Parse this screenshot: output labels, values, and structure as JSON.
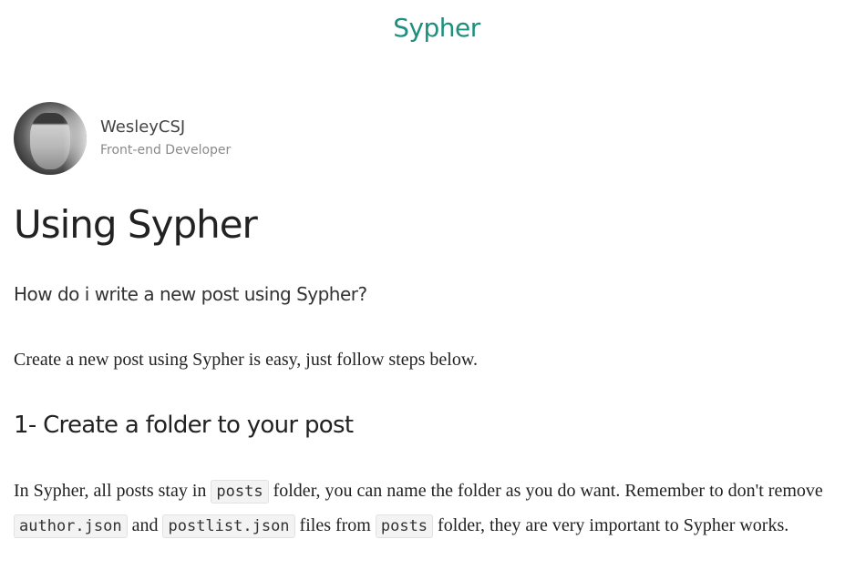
{
  "site": {
    "title": "Sypher"
  },
  "author": {
    "name": "WesleyCSJ",
    "role": "Front-end Developer"
  },
  "post": {
    "title": "Using Sypher",
    "subtitle": "How do i write a new post using Sypher?",
    "intro": "Create a new post using Sypher is easy, just follow steps below.",
    "section1": {
      "heading": "1- Create a folder to your post",
      "text1": "In Sypher, all posts stay in ",
      "code1": "posts",
      "text2": " folder, you can name the folder as you do want. Remember to don't remove ",
      "code2": "author.json",
      "text3": " and ",
      "code3": "postlist.json",
      "text4": " files from ",
      "code4": "posts",
      "text5": " folder, they are very important to Sypher works."
    }
  },
  "colors": {
    "accent": "#1e8f7f",
    "text": "#222222",
    "muted": "#8a8a8a"
  }
}
